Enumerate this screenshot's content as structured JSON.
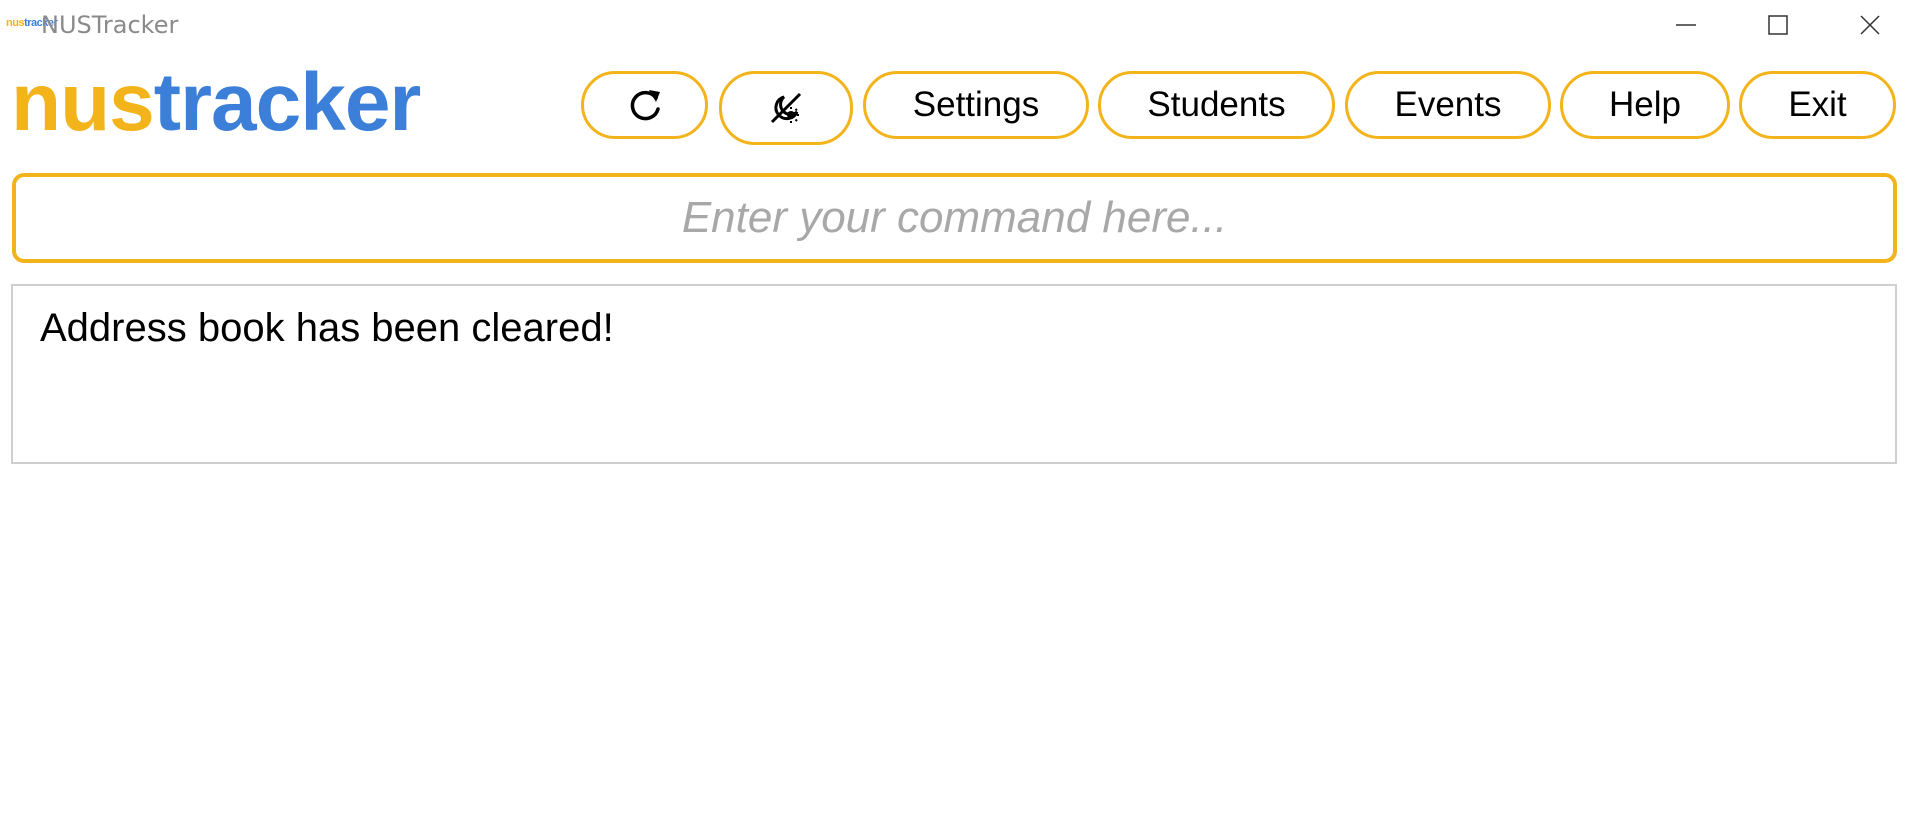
{
  "window": {
    "title": "NUSTracker",
    "icon": {
      "part1": "nus",
      "part2": "tracker"
    }
  },
  "logo": {
    "part1": "nus",
    "part2": "tracker"
  },
  "toolbar": {
    "refresh_icon": "refresh-icon",
    "theme_icon": "theme-toggle-icon",
    "settings_label": "Settings",
    "students_label": "Students",
    "events_label": "Events",
    "help_label": "Help",
    "exit_label": "Exit"
  },
  "command": {
    "value": "",
    "placeholder": "Enter your command here..."
  },
  "result": {
    "message": "Address book has been cleared!"
  },
  "colors": {
    "accent": "#f3b31b",
    "brand_blue": "#3c7fd9",
    "placeholder": "#a8a8a8",
    "window_title": "#8a8a8a"
  }
}
